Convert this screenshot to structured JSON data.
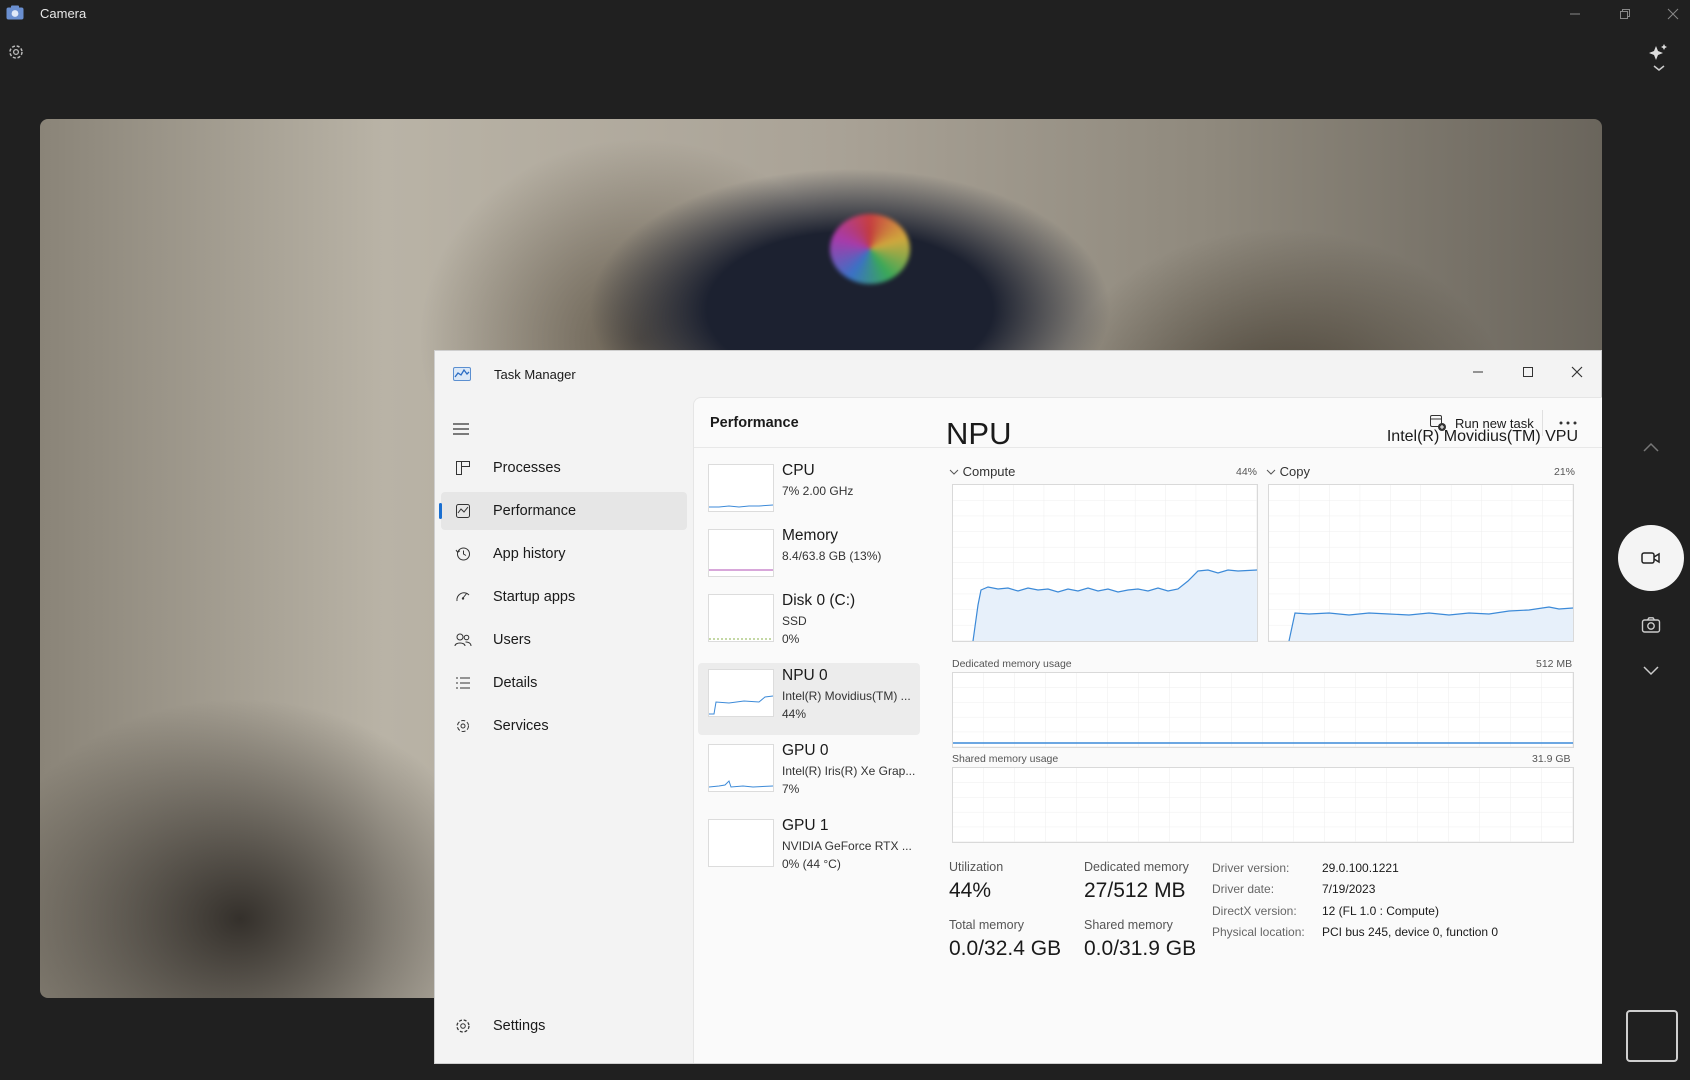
{
  "camera": {
    "title": "Camera",
    "icons": [
      "camera-app-icon",
      "settings-icon",
      "effects-icon",
      "chevron-up-icon",
      "video-mode-icon",
      "photo-mode-icon",
      "chevron-down-icon"
    ]
  },
  "task_manager": {
    "title": "Task Manager",
    "nav": [
      {
        "label": "Processes",
        "icon": "processes-icon"
      },
      {
        "label": "Performance",
        "icon": "performance-icon"
      },
      {
        "label": "App history",
        "icon": "history-icon"
      },
      {
        "label": "Startup apps",
        "icon": "startup-icon"
      },
      {
        "label": "Users",
        "icon": "users-icon"
      },
      {
        "label": "Details",
        "icon": "details-icon"
      },
      {
        "label": "Services",
        "icon": "services-icon"
      }
    ],
    "settings_label": "Settings",
    "header": {
      "title": "Performance",
      "run_new_task": "Run new task"
    },
    "devices": [
      {
        "name": "CPU",
        "line1": "7%  2.00 GHz",
        "line2": ""
      },
      {
        "name": "Memory",
        "line1": "8.4/63.8 GB (13%)",
        "line2": ""
      },
      {
        "name": "Disk 0 (C:)",
        "line1": "SSD",
        "line2": "0%"
      },
      {
        "name": "NPU 0",
        "line1": "Intel(R) Movidius(TM) ...",
        "line2": "44%"
      },
      {
        "name": "GPU 0",
        "line1": "Intel(R) Iris(R) Xe Grap...",
        "line2": "7%"
      },
      {
        "name": "GPU 1",
        "line1": "NVIDIA GeForce RTX ...",
        "line2": "0%  (44 °C)"
      }
    ],
    "detail": {
      "title": "NPU",
      "model": "Intel(R) Movidius(TM) VPU",
      "compute_label": "Compute",
      "compute_pct": "44%",
      "copy_label": "Copy",
      "copy_pct": "21%",
      "dedicated_label": "Dedicated memory usage",
      "dedicated_max": "512 MB",
      "shared_label": "Shared memory usage",
      "shared_max": "31.9 GB",
      "stats": {
        "utilization_label": "Utilization",
        "utilization": "44%",
        "dedicated_memory_label": "Dedicated memory",
        "dedicated_memory": "27/512 MB",
        "total_memory_label": "Total memory",
        "total_memory": "0.0/32.4 GB",
        "shared_memory_label": "Shared memory",
        "shared_memory": "0.0/31.9 GB"
      },
      "info": [
        {
          "key": "Driver version:",
          "value": "29.0.100.1221"
        },
        {
          "key": "Driver date:",
          "value": "7/19/2023"
        },
        {
          "key": "DirectX version:",
          "value": "12 (FL 1.0 : Compute)"
        },
        {
          "key": "Physical location:",
          "value": "PCI bus 245, device 0, function 0"
        }
      ]
    }
  },
  "colors": {
    "accent": "#1a6fd1",
    "graph_line": "#3c8ad8",
    "graph_fill": "#e7f0fa",
    "memory_line": "#b04fb4"
  }
}
